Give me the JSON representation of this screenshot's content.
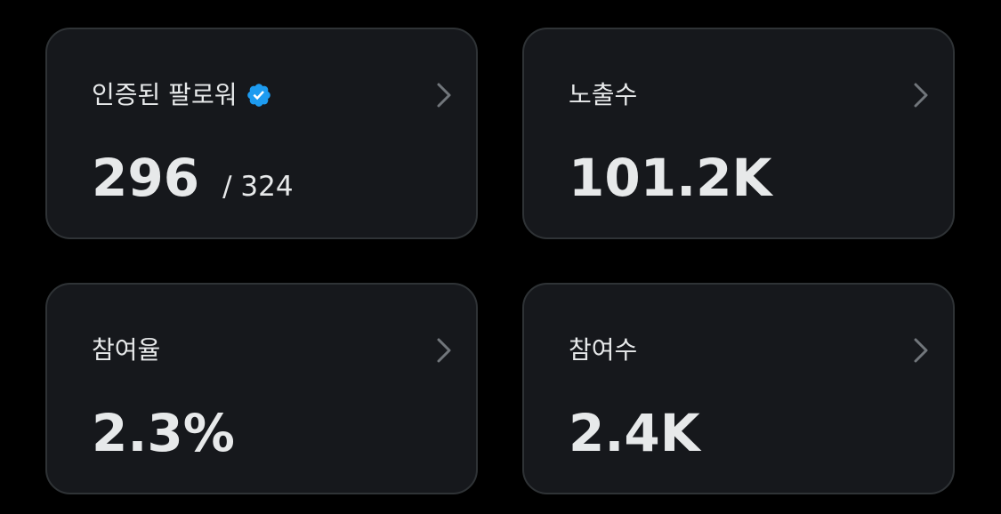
{
  "accent_color": "#1d9bf0",
  "cards": [
    {
      "label": "인증된 팔로워",
      "value": "296",
      "subvalue": "/ 324",
      "icon": "verified-badge-icon",
      "chevron_icon": "chevron-right-icon"
    },
    {
      "label": "노출수",
      "value": "101.2K",
      "chevron_icon": "chevron-right-icon"
    },
    {
      "label": "참여율",
      "value": "2.3%",
      "chevron_icon": "chevron-right-icon"
    },
    {
      "label": "참여수",
      "value": "2.4K",
      "chevron_icon": "chevron-right-icon"
    }
  ]
}
